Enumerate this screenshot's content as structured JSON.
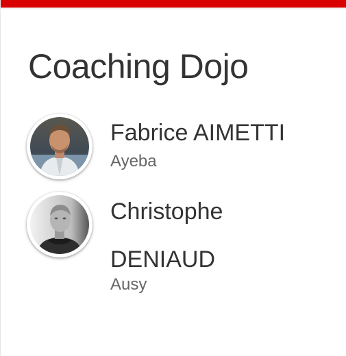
{
  "accent_color": "#d90000",
  "title": "Coaching Dojo",
  "speakers": [
    {
      "name": "Fabrice AIMETTI",
      "company": "Ayeba",
      "avatar_icon": "speaker-photo"
    },
    {
      "name": "Christophe DENIAUD",
      "company": "Ausy",
      "avatar_icon": "speaker-photo-bw"
    }
  ]
}
